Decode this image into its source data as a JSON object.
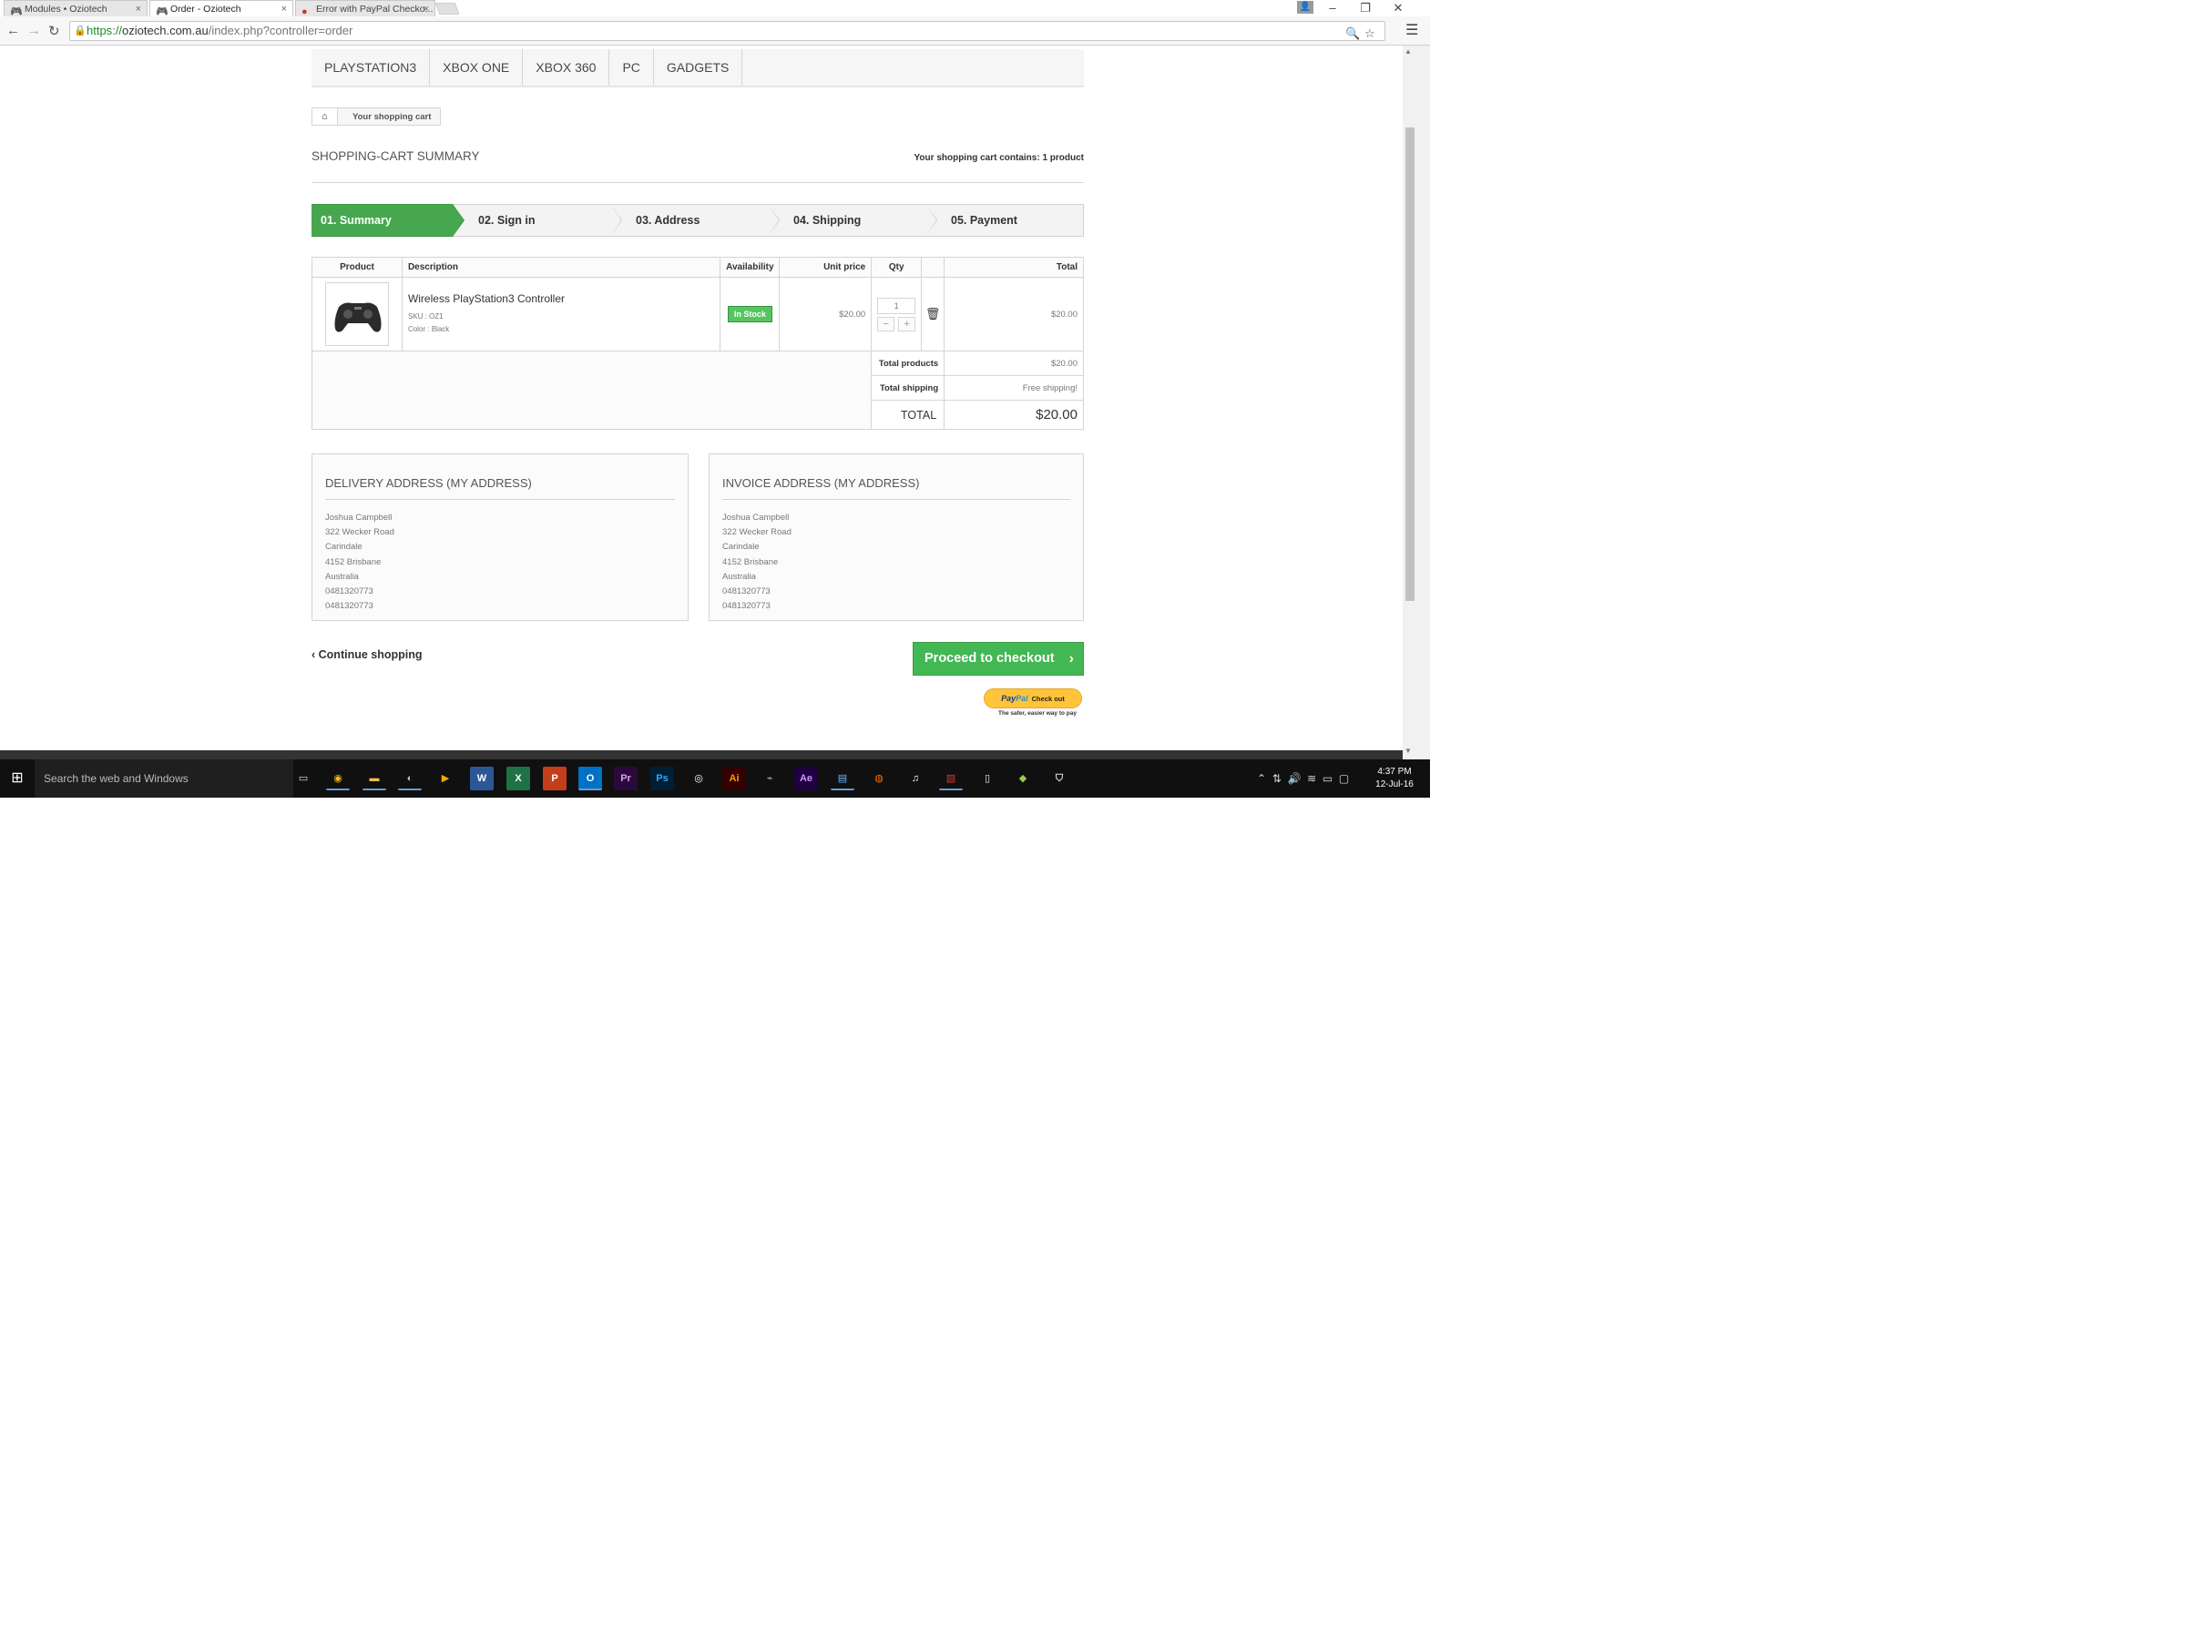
{
  "browser": {
    "tabs": [
      {
        "label": "Modules • Oziotech",
        "icon": "gamepad-icon",
        "active": false
      },
      {
        "label": "Order - Oziotech",
        "icon": "gamepad-icon",
        "active": true
      },
      {
        "label": "Error with PayPal Checko...",
        "icon": "paypal-icon",
        "active": false
      }
    ],
    "url_scheme": "https://",
    "url_host": "oziotech.com.au",
    "url_path": "/index.php?controller=order"
  },
  "nav": {
    "items": [
      "PLAYSTATION3",
      "XBOX ONE",
      "XBOX 360",
      "PC",
      "GADGETS"
    ]
  },
  "breadcrumb": {
    "home_icon": "home-icon",
    "current": "Your shopping cart"
  },
  "cart": {
    "title": "SHOPPING-CART SUMMARY",
    "count_prefix": "Your shopping cart contains:",
    "count_value": "1 product"
  },
  "steps": [
    "01. Summary",
    "02. Sign in",
    "03. Address",
    "04. Shipping",
    "05. Payment"
  ],
  "table": {
    "headers": {
      "product": "Product",
      "description": "Description",
      "availability": "Availability",
      "unit_price": "Unit price",
      "qty": "Qty",
      "total": "Total"
    },
    "row": {
      "name": "Wireless PlayStation3 Controller",
      "sku": "SKU : OZ1",
      "color": "Color : Black",
      "availability": "In Stock",
      "unit_price": "$20.00",
      "qty": "1",
      "qty_minus": "−",
      "qty_plus": "+",
      "total": "$20.00"
    },
    "summary": {
      "total_products_label": "Total products",
      "total_products_value": "$20.00",
      "total_shipping_label": "Total shipping",
      "total_shipping_value": "Free shipping!",
      "total_label": "TOTAL",
      "total_value": "$20.00"
    }
  },
  "delivery_address": {
    "title": "DELIVERY ADDRESS (MY ADDRESS)",
    "lines": [
      "Joshua Campbell",
      "322 Wecker Road",
      "Carindale",
      "4152 Brisbane",
      "Australia",
      "0481320773",
      "0481320773"
    ]
  },
  "invoice_address": {
    "title": "INVOICE ADDRESS (MY ADDRESS)",
    "lines": [
      "Joshua Campbell",
      "322 Wecker Road",
      "Carindale",
      "4152 Brisbane",
      "Australia",
      "0481320773",
      "0481320773"
    ]
  },
  "actions": {
    "continue": "Continue shopping",
    "checkout": "Proceed to checkout",
    "paypal_pay": "Pay",
    "paypal_pal": "Pal",
    "paypal_checkout": "Check out",
    "paypal_tagline": "The safer, easier way to pay"
  },
  "taskbar": {
    "search_placeholder": "Search the web and Windows",
    "time": "4:37 PM",
    "date": "12-Jul-16"
  },
  "colors": {
    "accent_green": "#46a74e",
    "checkout_green": "#43b754",
    "paypal_yellow": "#ffc439"
  }
}
